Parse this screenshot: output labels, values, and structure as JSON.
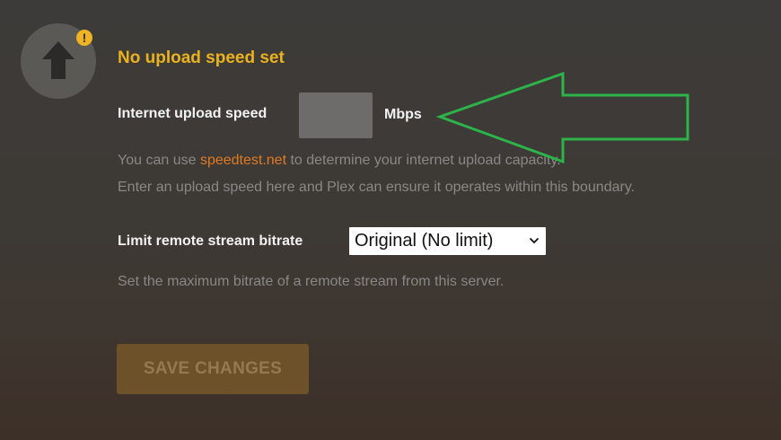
{
  "colors": {
    "accent": "#ebb220",
    "link": "#e07a23",
    "annotation_arrow": "#2db34a"
  },
  "status": {
    "icon": "upload-arrow-icon",
    "warning_icon": "warning-icon",
    "warning_symbol": "!",
    "heading": "No upload speed set"
  },
  "upload_speed": {
    "label": "Internet upload speed",
    "value": "",
    "unit": "Mbps",
    "help_prefix": "You can use ",
    "help_link": "speedtest.net",
    "help_suffix": " to determine your internet upload capacity.",
    "help_line2": "Enter an upload speed here and Plex can ensure it operates within this boundary."
  },
  "remote_bitrate": {
    "label": "Limit remote stream bitrate",
    "selected": "Original (No limit)",
    "help": "Set the maximum bitrate of a remote stream from this server."
  },
  "actions": {
    "save_label": "SAVE CHANGES"
  }
}
